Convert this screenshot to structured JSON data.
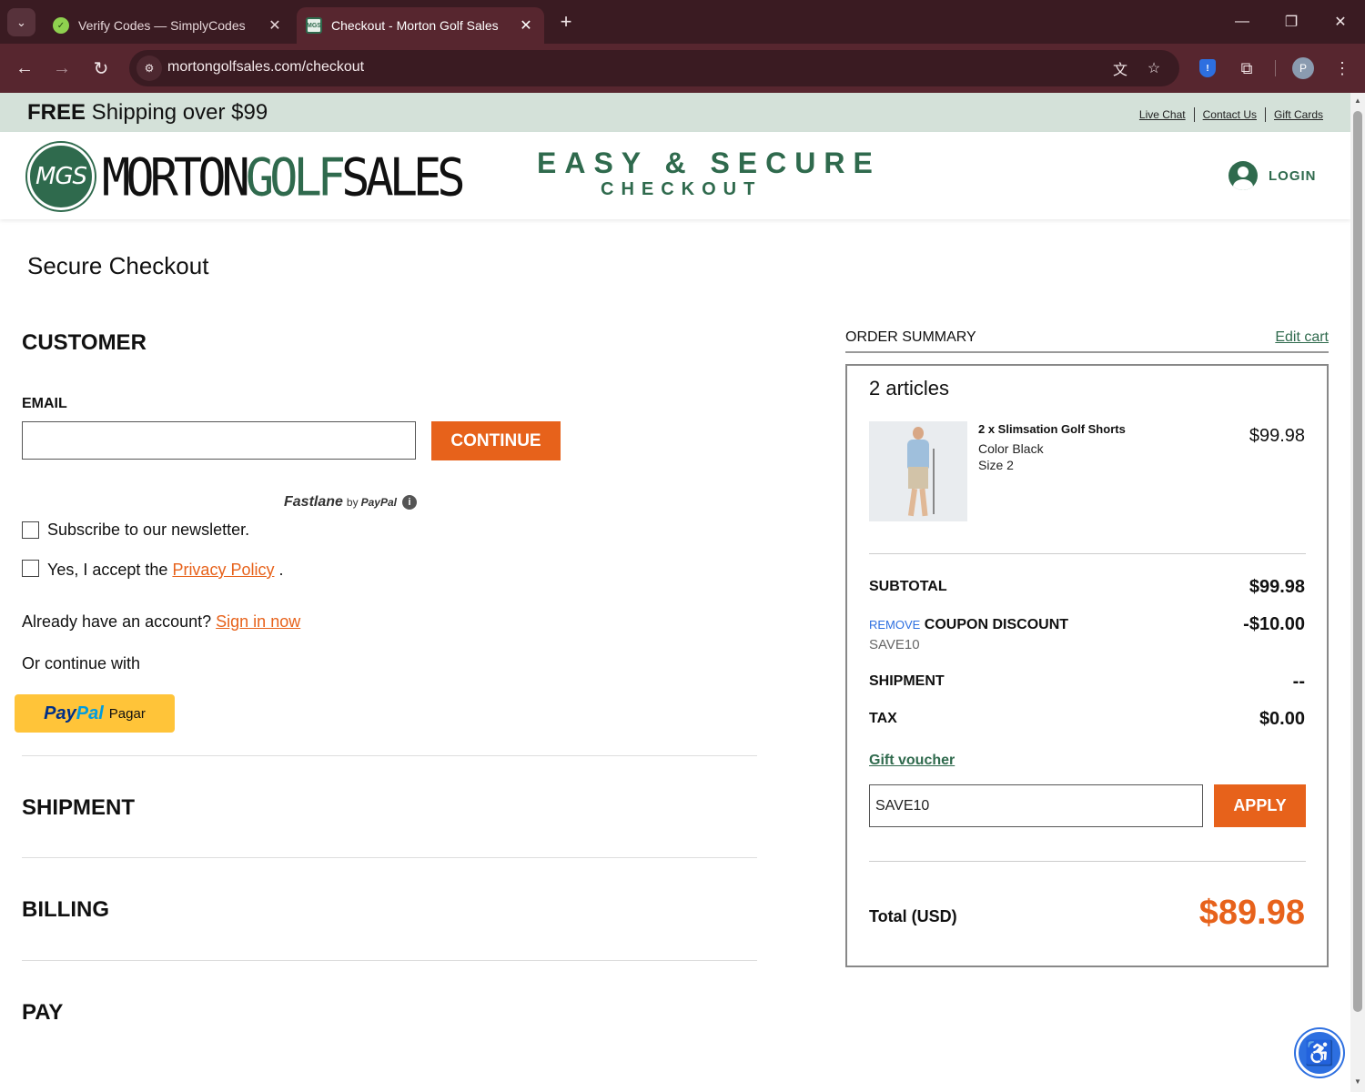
{
  "browser": {
    "tabs": [
      {
        "title": "Verify Codes — SimplyCodes",
        "active": false,
        "favicon": "simplycodes-icon"
      },
      {
        "title": "Checkout - Morton Golf Sales",
        "active": true,
        "favicon": "mgs-icon"
      }
    ],
    "url": "mortongolfsales.com/checkout",
    "profile_initial": "P"
  },
  "promo_bar": {
    "free_bold": "FREE",
    "shipping_text": " Shipping over $99",
    "links": [
      "Live Chat",
      "Contact Us",
      "Gift Cards"
    ]
  },
  "header": {
    "logo_badge": "MGS",
    "logo_morton": "MORTON",
    "logo_golf": "GOLF",
    "logo_sales": "SALES",
    "tagline_top": "EASY & SECURE",
    "tagline_bottom": "CHECKOUT",
    "login_label": "LOGIN"
  },
  "page_title": "Secure Checkout",
  "customer": {
    "heading": "CUSTOMER",
    "email_label": "EMAIL",
    "email_value": "",
    "continue_label": "CONTINUE",
    "fastlane": "Fastlane",
    "fastlane_by": "by",
    "fastlane_paypal": "PayPal",
    "newsletter_label": "Subscribe to our newsletter.",
    "privacy_prefix": "Yes, I accept the ",
    "privacy_link": "Privacy Policy",
    "privacy_suffix": " .",
    "account_prefix": "Already have an account? ",
    "account_link": "Sign in now",
    "or_continue": "Or continue with",
    "paypal_pay": "Pay",
    "paypal_pal": "Pal",
    "paypal_pagar": "Pagar"
  },
  "sections": {
    "shipment": "SHIPMENT",
    "billing": "BILLING",
    "pay": "PAY"
  },
  "order_summary": {
    "heading": "ORDER SUMMARY",
    "edit_cart": "Edit cart",
    "articles": "2 articles",
    "item": {
      "name": "2 x Slimsation Golf Shorts",
      "color": "Color Black",
      "size": "Size 2",
      "price": "$99.98"
    },
    "subtotal_label": "SUBTOTAL",
    "subtotal_value": "$99.98",
    "remove_label": "REMOVE",
    "coupon_label": "COUPON DISCOUNT",
    "coupon_value": "-$10.00",
    "coupon_code": "SAVE10",
    "shipment_label": "SHIPMENT",
    "shipment_value": "--",
    "tax_label": "TAX",
    "tax_value": "$0.00",
    "gift_voucher": "Gift voucher",
    "voucher_value": "SAVE10",
    "apply_label": "APPLY",
    "total_label": "Total (USD)",
    "total_value": "$89.98"
  },
  "colors": {
    "brand_green": "#2f6a4d",
    "accent_orange": "#e7621b",
    "paypal_yellow": "#ffc439",
    "browser_frame": "#57262f"
  }
}
